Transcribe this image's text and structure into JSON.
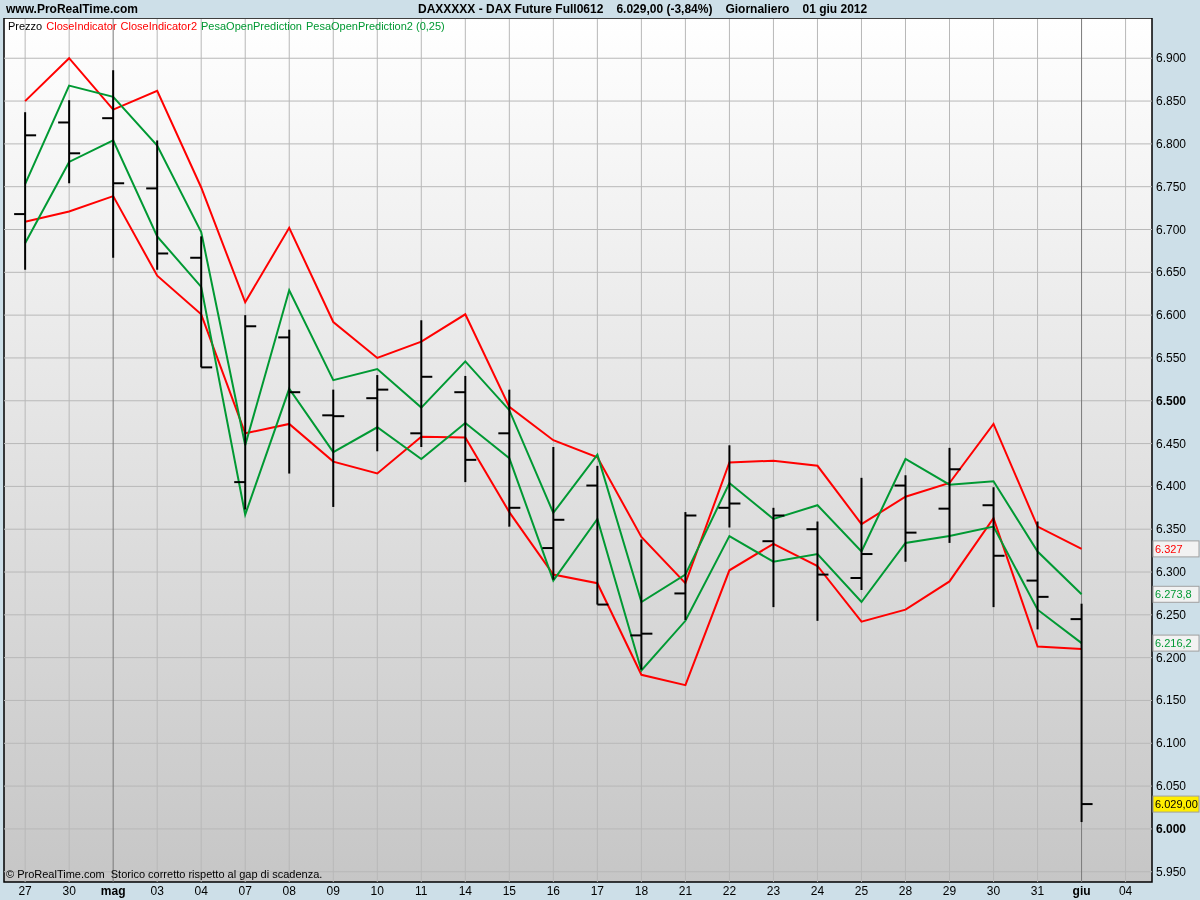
{
  "header": {
    "site": "www.ProRealTime.com",
    "instrument": "DAXXXXX - DAX Future Full0612",
    "quote": "6.029,00 (-3,84%)",
    "timeframe": "Giornaliero",
    "date": "01 giu 2012"
  },
  "footer": {
    "copyright": "© ProRealTime.com",
    "note": "Storico corretto rispetto al gap di scadenza."
  },
  "price": {
    "name": "Prezzo",
    "color": "#000000"
  },
  "chart_data": {
    "type": "line",
    "grid": true,
    "ylim": [
      5938,
      6947
    ],
    "categories": [
      "27",
      "30",
      "mag",
      "03",
      "04",
      "07",
      "08",
      "09",
      "10",
      "11",
      "14",
      "15",
      "16",
      "17",
      "18",
      "21",
      "22",
      "23",
      "24",
      "25",
      "28",
      "29",
      "30",
      "31",
      "giu",
      "04"
    ],
    "yticks": [
      {
        "value": 6900,
        "label": "6.900"
      },
      {
        "value": 6850,
        "label": "6.850"
      },
      {
        "value": 6800,
        "label": "6.800"
      },
      {
        "value": 6750,
        "label": "6.750"
      },
      {
        "value": 6700,
        "label": "6.700"
      },
      {
        "value": 6650,
        "label": "6.650"
      },
      {
        "value": 6600,
        "label": "6.600"
      },
      {
        "value": 6550,
        "label": "6.550"
      },
      {
        "value": 6500,
        "label": "6.500"
      },
      {
        "value": 6450,
        "label": "6.450"
      },
      {
        "value": 6400,
        "label": "6.400"
      },
      {
        "value": 6350,
        "label": "6.350"
      },
      {
        "value": 6300,
        "label": "6.300"
      },
      {
        "value": 6250,
        "label": "6.250"
      },
      {
        "value": 6200,
        "label": "6.200"
      },
      {
        "value": 6150,
        "label": "6.150"
      },
      {
        "value": 6100,
        "label": "6.100"
      },
      {
        "value": 6050,
        "label": "6.050"
      },
      {
        "value": 6000,
        "label": "6.000"
      },
      {
        "value": 5950,
        "label": "5.950"
      }
    ],
    "series": [
      {
        "name": "CloseIndicator",
        "color": "#ff0000",
        "values": [
          6850,
          6900,
          6840,
          6862,
          6749,
          6615,
          6702,
          6592,
          6550,
          6569,
          6601,
          6493,
          6454,
          6434,
          6341,
          6287,
          6428,
          6430,
          6424,
          6356,
          6388,
          6404,
          6473,
          6353,
          6327,
          null
        ]
      },
      {
        "name": "CloseIndicator2",
        "color": "#ff0000",
        "values": [
          6709,
          6721,
          6739,
          6646,
          6601,
          6462,
          6473,
          6429,
          6415,
          6458,
          6457,
          6370,
          6297,
          6287,
          6180,
          6168,
          6302,
          6333,
          6307,
          6242,
          6256,
          6289,
          6363,
          6213,
          6210,
          null
        ]
      },
      {
        "name": "PesaOpenPrediction",
        "color": "#009933",
        "values": [
          6753,
          6868,
          6855,
          6798,
          6697,
          6448,
          6629,
          6524,
          6537,
          6492,
          6546,
          6489,
          6369,
          6437,
          6265,
          6297,
          6404,
          6362,
          6378,
          6324,
          6432,
          6402,
          6406,
          6324,
          6274,
          null
        ]
      },
      {
        "name": "PesaOpenPrediction2 (0,25)",
        "color": "#009933",
        "values": [
          6684,
          6779,
          6804,
          6692,
          6633,
          6367,
          6514,
          6440,
          6469,
          6432,
          6474,
          6433,
          6290,
          6362,
          6185,
          6243,
          6342,
          6312,
          6321,
          6265,
          6334,
          6342,
          6353,
          6256,
          6217,
          null
        ]
      }
    ]
  },
  "category_bold": [
    false,
    false,
    true,
    false,
    false,
    false,
    false,
    false,
    false,
    false,
    false,
    false,
    false,
    false,
    false,
    false,
    false,
    false,
    false,
    false,
    false,
    false,
    false,
    false,
    true,
    false
  ],
  "ytick_bold": [
    false,
    false,
    false,
    false,
    false,
    false,
    false,
    false,
    true,
    false,
    false,
    false,
    false,
    false,
    false,
    false,
    false,
    false,
    true,
    false
  ],
  "series_tags": [
    {
      "visible": true,
      "text": "6.327"
    },
    {
      "visible": false
    },
    {
      "visible": true,
      "text": "6.273,8"
    },
    {
      "visible": true,
      "text": "6.216,2"
    }
  ],
  "price_tag": {
    "text": "6.029,00"
  }
}
